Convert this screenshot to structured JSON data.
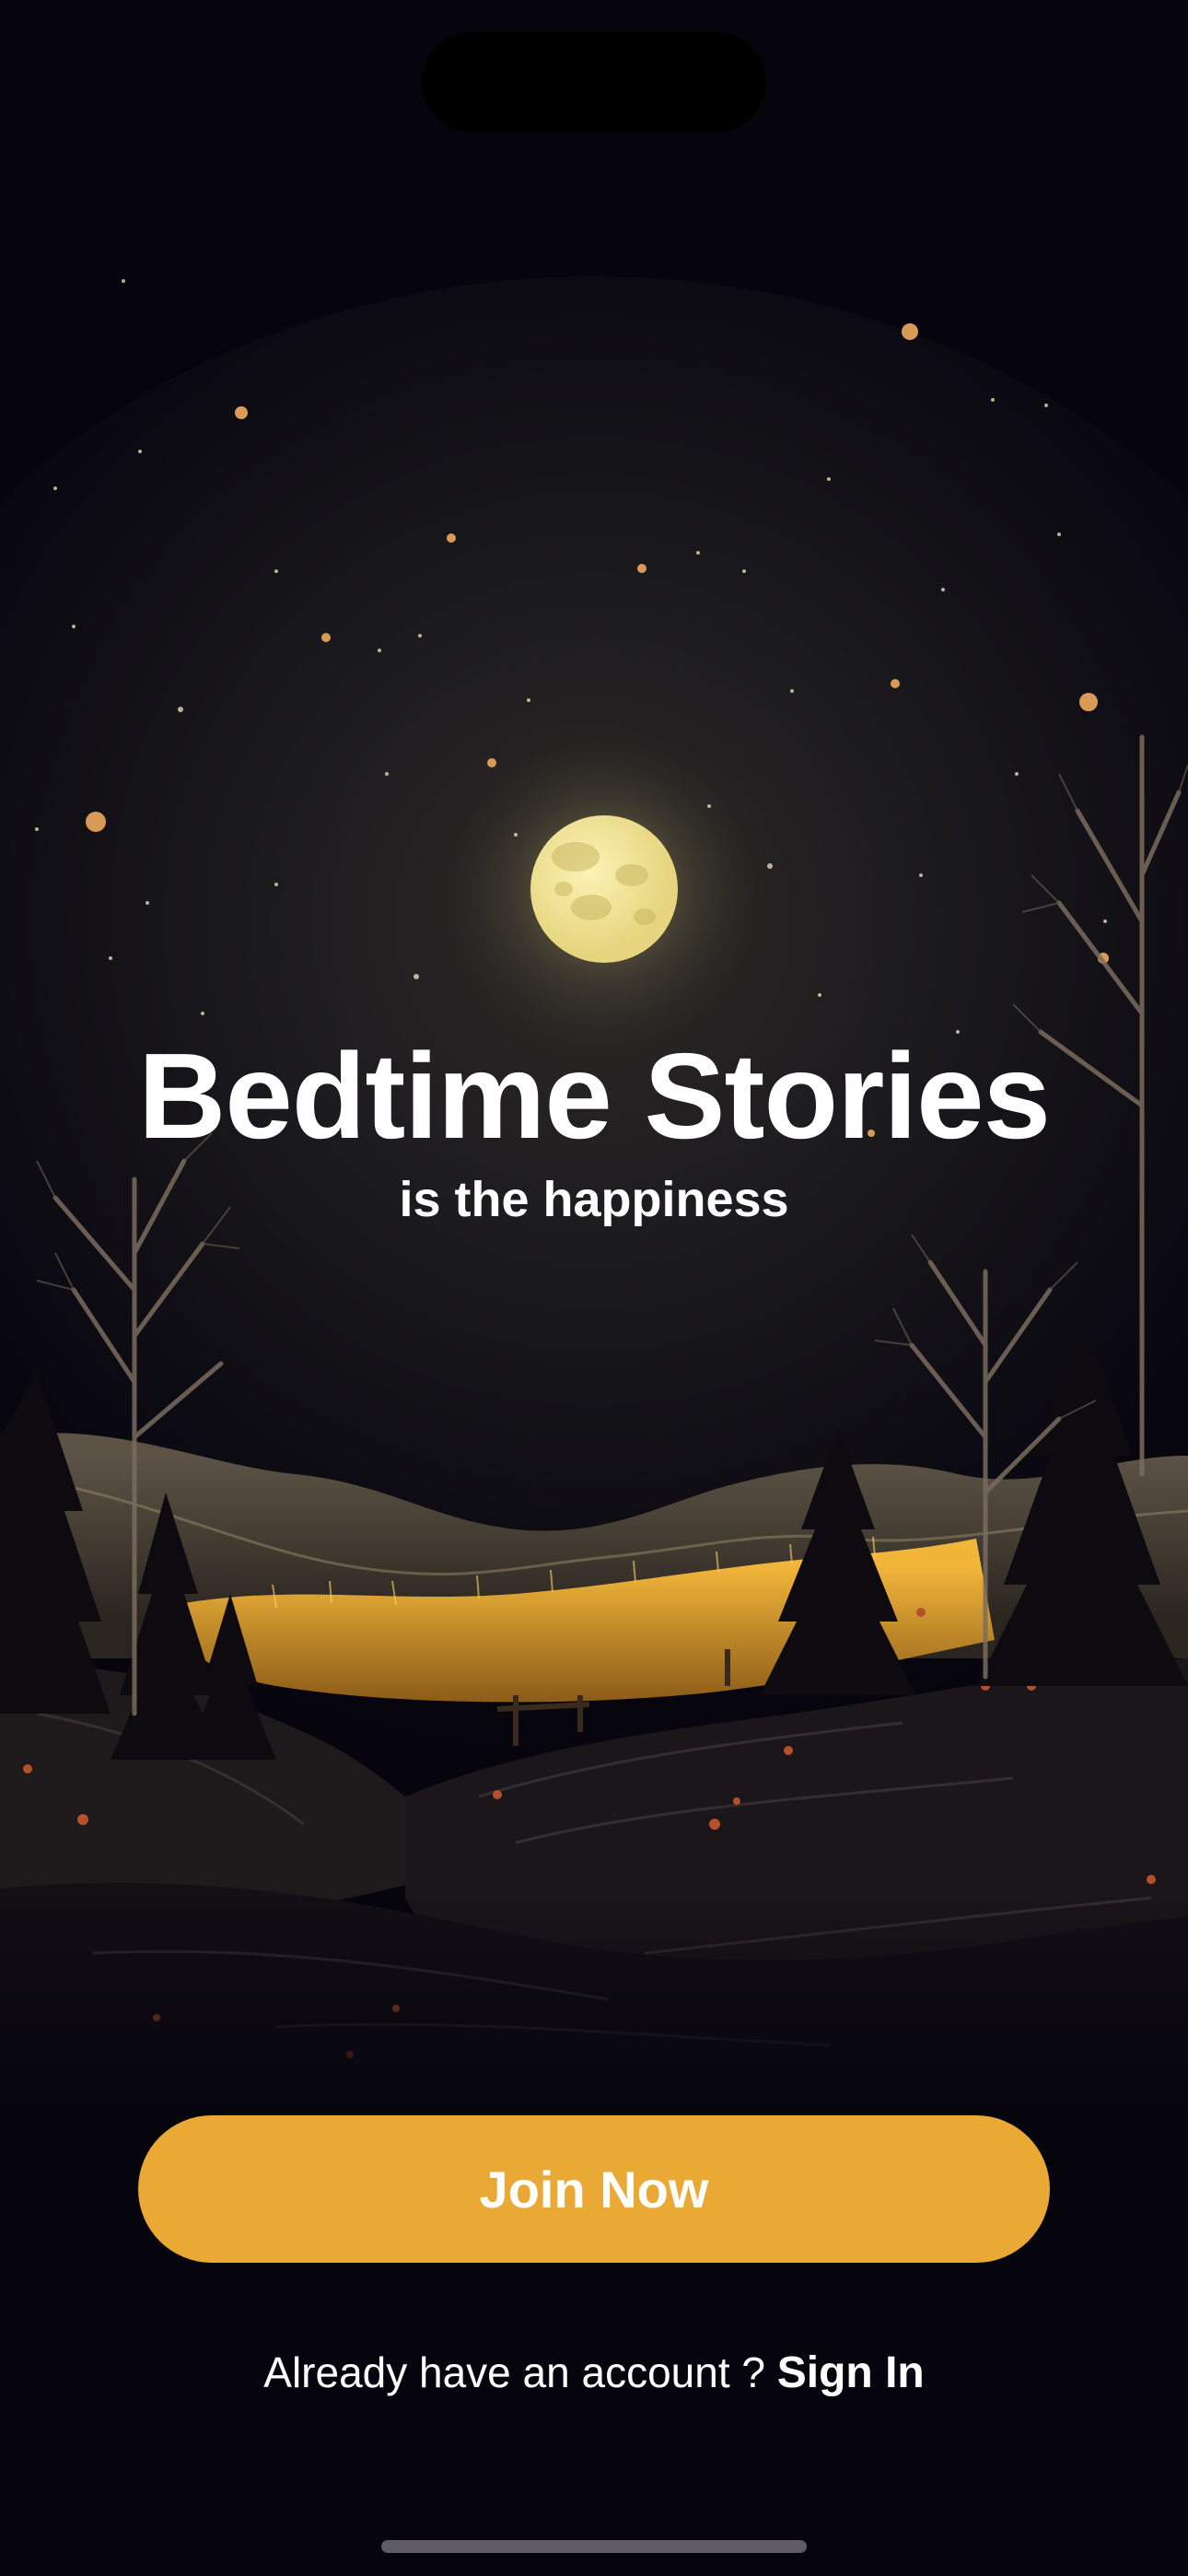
{
  "welcome": {
    "title": "Bedtime Stories",
    "subtitle": "is the happiness",
    "join_button_label": "Join Now",
    "signin_prompt": "Already have an account ?",
    "signin_link_label": "Sign In"
  },
  "illustration": {
    "subject": "moonlit-night-landscape"
  },
  "colors": {
    "background": "#06040d",
    "accent": "#e9a934",
    "text": "#ffffff",
    "moon": "#f1e79a"
  }
}
